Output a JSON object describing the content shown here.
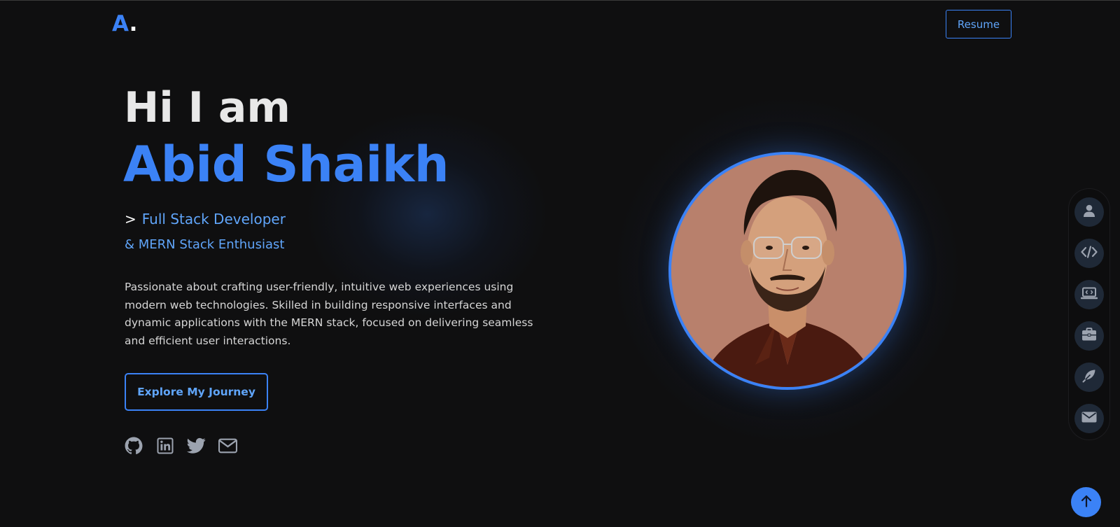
{
  "nav": {
    "logo_letter": "A",
    "logo_dot": ".",
    "resume_label": "Resume"
  },
  "hero": {
    "greeting": "Hi I am",
    "name": "Abid Shaikh",
    "role_prefix": ">",
    "role_primary": "Full Stack Developer",
    "role_secondary": "& MERN Stack Enthusiast",
    "description": "Passionate about crafting user-friendly, intuitive web experiences using modern web technologies. Skilled in building responsive interfaces and dynamic applications with the MERN stack, focused on delivering seamless and efficient user interactions.",
    "cta_label": "Explore My Journey"
  },
  "socials": [
    {
      "icon": "github-icon"
    },
    {
      "icon": "linkedin-icon"
    },
    {
      "icon": "twitter-icon"
    },
    {
      "icon": "envelope-icon"
    }
  ],
  "sidenav": [
    {
      "icon": "user-icon"
    },
    {
      "icon": "code-icon"
    },
    {
      "icon": "laptop-code-icon"
    },
    {
      "icon": "briefcase-icon"
    },
    {
      "icon": "feather-icon"
    },
    {
      "icon": "envelope-icon"
    }
  ],
  "scroll_top_icon": "arrow-up-icon",
  "colors": {
    "background": "#0f0f10",
    "accent": "#3b82f6",
    "accent_light": "#60a5fa",
    "text": "#e8e8e8",
    "icon_gray": "#9ca3af",
    "sidenav_item": "#1f2937"
  }
}
